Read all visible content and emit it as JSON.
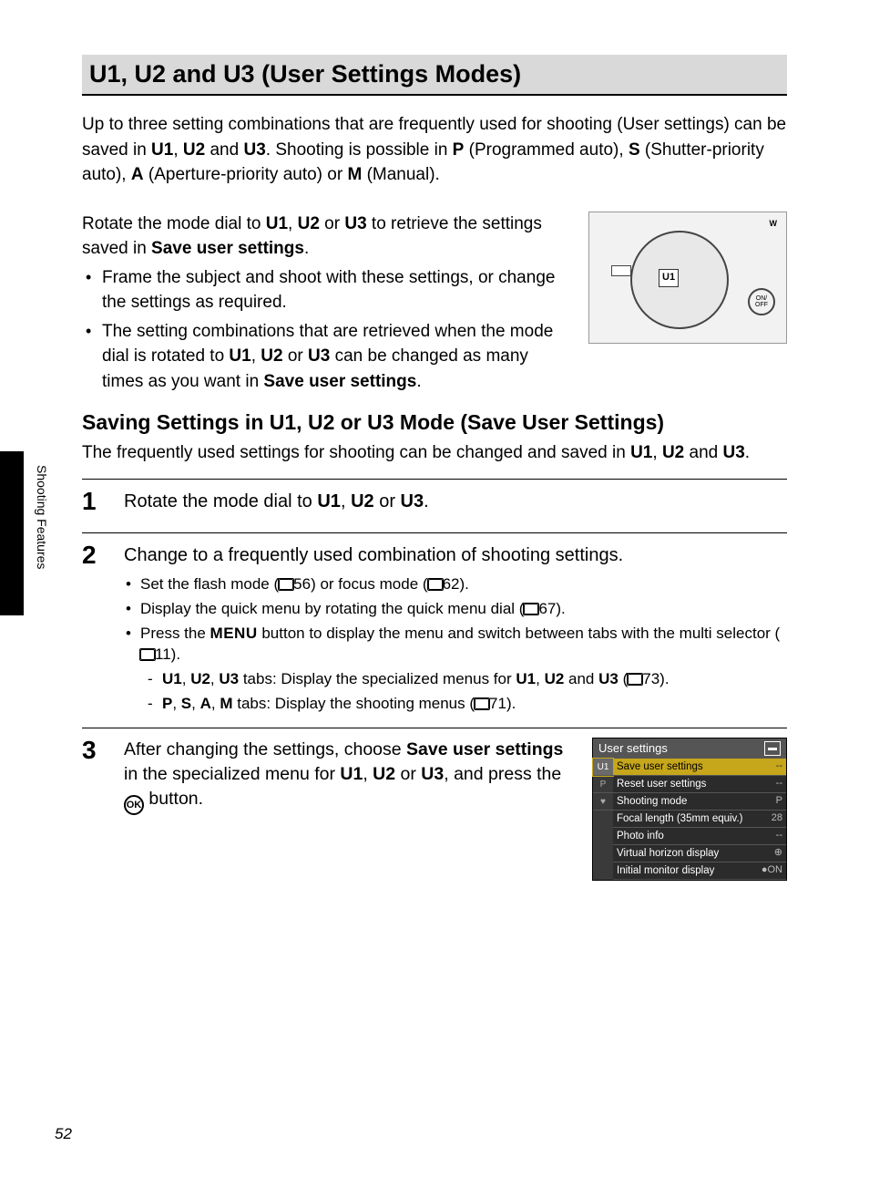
{
  "side_label": "Shooting Features",
  "page_number": "52",
  "title": {
    "u1": "U1",
    "sep1": ", ",
    "u2": "U2",
    "and": " and ",
    "u3": "U3",
    "suffix": " (User Settings Modes)"
  },
  "intro": {
    "p1a": "Up to three setting combinations that are frequently used for shooting (User settings) can be saved in ",
    "u1": "U1",
    "c1": ", ",
    "u2": "U2",
    "c2": " and ",
    "u3": "U3",
    "p1b": ". Shooting is possible in ",
    "p": "P",
    "p1c": " (Programmed auto), ",
    "s": "S",
    "p1d": " (Shutter-priority auto), ",
    "a": "A",
    "p1e": " (Aperture-priority auto) or ",
    "m": "M",
    "p1f": " (Manual)."
  },
  "rotate_block": {
    "lead_a": "Rotate the mode dial to ",
    "u1": "U1",
    "c1": ", ",
    "u2": "U2",
    "c2": " or ",
    "u3": "U3",
    "lead_b": " to retrieve the settings saved in ",
    "bold": "Save user settings",
    "lead_c": ".",
    "b1": "Frame the subject and shoot with these settings, or change the settings as required.",
    "b2a": "The setting combinations that are retrieved when the mode dial is rotated to ",
    "b2_u1": "U1",
    "b2_c1": ", ",
    "b2_u2": "U2",
    "b2_c2": " or ",
    "b2_u3": "U3",
    "b2b": " can be changed as many times as you want in ",
    "b2_bold": "Save user settings",
    "b2c": "."
  },
  "dial": {
    "u1": "U1",
    "onoff": "ON/\nOFF",
    "w": "W"
  },
  "subheading": {
    "a": "Saving Settings in ",
    "u1": "U1",
    "c1": ", ",
    "u2": "U2",
    "c2": " or ",
    "u3": "U3",
    "b": " Mode (Save User Settings)"
  },
  "subintro": {
    "a": "The frequently used settings for shooting can be changed and saved in ",
    "u1": "U1",
    "c1": ", ",
    "u2": "U2",
    "c2": " and ",
    "u3": "U3",
    "b": "."
  },
  "step1": {
    "num": "1",
    "a": "Rotate the mode dial to ",
    "u1": "U1",
    "c1": ", ",
    "u2": "U2",
    "c2": " or ",
    "u3": "U3",
    "b": "."
  },
  "step2": {
    "num": "2",
    "lead": "Change to a frequently used combination of shooting settings.",
    "b1a": "Set the flash mode (",
    "b1ref": "56",
    "b1b": ") or focus mode (",
    "b1ref2": "62",
    "b1c": ").",
    "b2a": "Display the quick menu by rotating the quick menu dial (",
    "b2ref": "67",
    "b2b": ").",
    "b3a": "Press the ",
    "b3menu": "MENU",
    "b3b": " button to display the menu and switch between tabs with the multi selector (",
    "b3ref": "11",
    "b3c": ").",
    "d1_u1": "U1",
    "d1_c1": ", ",
    "d1_u2": "U2",
    "d1_c2": ", ",
    "d1_u3": "U3",
    "d1a": " tabs: Display the specialized menus for ",
    "d1_u1b": "U1",
    "d1_c3": ", ",
    "d1_u2b": "U2",
    "d1_c4": " and ",
    "d1_u3b": "U3",
    "d1b": " (",
    "d1ref": "73",
    "d1c": ").",
    "d2_p": "P",
    "d2_c1": ", ",
    "d2_s": "S",
    "d2_c2": ", ",
    "d2_a": "A",
    "d2_c3": ", ",
    "d2_m": "M",
    "d2a": " tabs: Display the shooting menus (",
    "d2ref": "71",
    "d2b": ")."
  },
  "step3": {
    "num": "3",
    "a": "After changing the settings, choose ",
    "bold": "Save user settings",
    "b": " in the specialized menu for ",
    "u1": "U1",
    "c1": ", ",
    "u2": "U2",
    "c2": " or ",
    "u3": "U3",
    "c": ", and press the ",
    "ok": "k",
    "d": " button."
  },
  "menu": {
    "header": "User settings",
    "tabs": {
      "t1": "U1",
      "t2": "P",
      "t3": "♥"
    },
    "rows": [
      {
        "label": "Save user settings",
        "val": "--"
      },
      {
        "label": "Reset user settings",
        "val": "--"
      },
      {
        "label": "Shooting mode",
        "val": "P"
      },
      {
        "label": "Focal length (35mm equiv.)",
        "val": "28"
      },
      {
        "label": "Photo info",
        "val": "--"
      },
      {
        "label": "Virtual horizon display",
        "val": "⊕"
      },
      {
        "label": "Initial monitor display",
        "val": "●ON"
      }
    ]
  }
}
